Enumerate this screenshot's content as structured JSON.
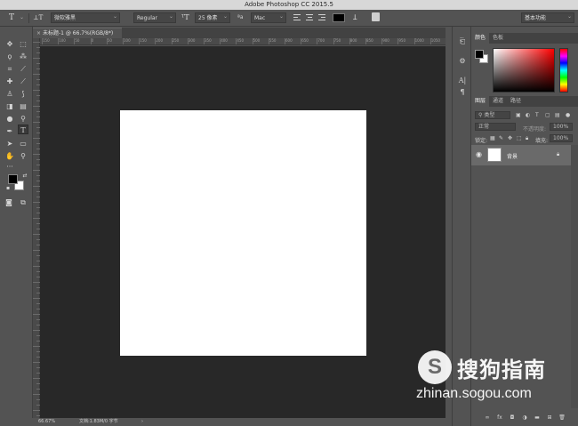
{
  "app": {
    "title": "Adobe Photoshop CC 2015.5"
  },
  "options_bar": {
    "tool_icon": "type-tool-icon",
    "font_family": "微软雅黑",
    "font_style": "Regular",
    "font_size": "25 像素",
    "antialias": "Mac",
    "text_color": "#000000",
    "workspace": "基本功能"
  },
  "document": {
    "tab_label": "未标题-1 @ 66.7%(RGB/8*)",
    "canvas_color": "#ffffff",
    "workspace_color": "#282828"
  },
  "ruler": {
    "labels": [
      "150",
      "100",
      "50",
      "0",
      "50",
      "100",
      "150",
      "200",
      "250",
      "300",
      "350",
      "400",
      "450",
      "500",
      "550",
      "600",
      "650",
      "700",
      "750",
      "800",
      "850",
      "900",
      "950",
      "1000",
      "1050"
    ]
  },
  "status_bar": {
    "zoom": "66.67%",
    "doc_info": "文档:1.83M/0 字节"
  },
  "color_panel": {
    "tabs": [
      "颜色",
      "色板"
    ],
    "foreground": "#000000",
    "background": "#ffffff"
  },
  "layers_panel": {
    "tabs": [
      "图层",
      "通道",
      "路径"
    ],
    "filter_kind": "类型",
    "blend_mode": "正常",
    "opacity_label": "不透明度:",
    "opacity_value": "100%",
    "lock_label": "锁定:",
    "fill_label": "填充:",
    "fill_value": "100%",
    "layers": [
      {
        "name": "背景",
        "visible": true,
        "locked": true
      }
    ]
  },
  "watermark": {
    "logo_letter": "S",
    "brand": "搜狗指南",
    "url": "zhinan.sogou.com"
  }
}
